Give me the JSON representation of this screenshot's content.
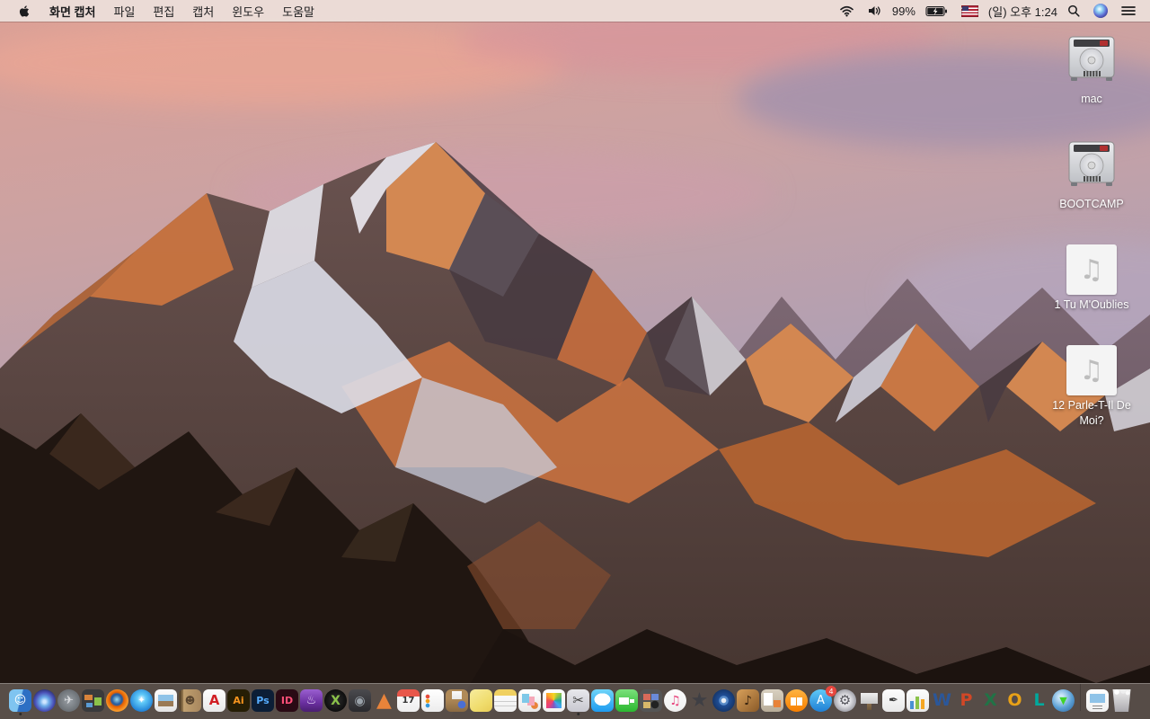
{
  "menu_bar": {
    "apple_menu": {
      "icon": "apple-logo"
    },
    "items": [
      {
        "id": "app-name",
        "label": "화면 캡처",
        "bold": true
      },
      {
        "id": "file",
        "label": "파일"
      },
      {
        "id": "edit",
        "label": "편집"
      },
      {
        "id": "capture",
        "label": "캡처"
      },
      {
        "id": "window",
        "label": "윈도우"
      },
      {
        "id": "help",
        "label": "도움말"
      }
    ],
    "status": {
      "wifi_icon": "wifi",
      "volume_icon": "speaker-on",
      "battery_percent": "99%",
      "battery_icon": "battery-charging",
      "input_source_icon": "us-flag",
      "clock": "(일) 오후 1:24",
      "spotlight_icon": "magnifier",
      "siri_icon": "siri-orb",
      "notification_icon": "list-lines"
    }
  },
  "desktop": {
    "icons": [
      {
        "id": "mac",
        "label": "mac",
        "type": "drive"
      },
      {
        "id": "bootcamp",
        "label": "BOOTCAMP",
        "type": "drive"
      },
      {
        "id": "tu-moublies",
        "label": "1 Tu M'Oublies",
        "type": "audio",
        "glyph": "♫"
      },
      {
        "id": "parle-t-il-de-moi",
        "label": "12 Parle-T-Il De Moi?",
        "type": "audio",
        "glyph": "♫"
      }
    ]
  },
  "dock": {
    "items": [
      {
        "id": "finder",
        "shape": "rounded",
        "bg": "linear-gradient(105deg,#7fc4f0 48%,#2d6fc4 52%)",
        "glyph": "☺",
        "glyph_color": "#ffffff",
        "glyph_size": 13,
        "running": true
      },
      {
        "id": "siri",
        "shape": "circle",
        "bg": "radial-gradient(circle at 50% 55%,#cfe6ff 8%,#6aa9e8 28%,#4b52b8 55%,#1e2250 85%)"
      },
      {
        "id": "launchpad",
        "shape": "circle",
        "bg": "radial-gradient(circle,#9aa0a6 0%,#6b7075 70%,#55585c 100%)",
        "glyph": "✈",
        "glyph_color": "#d8dadd",
        "glyph_size": 13
      },
      {
        "id": "mission-control",
        "shape": "rounded",
        "bg": "linear-gradient(#d8833b,#d8833b) 3px 6px/9px 6px no-repeat, linear-gradient(#8bc34a,#8bc34a) 14px 9px/8px 9px no-repeat, linear-gradient(#5a9bd4,#5a9bd4) 5px 15px/7px 5px no-repeat, #3a3a3c"
      },
      {
        "id": "firefox",
        "shape": "circle",
        "bg": "radial-gradient(circle at 48% 45%,#9adcf0 0%,#2a5d9e 28%,#2a5d9e 33%,#e66000 42%,#f79c2d 68%,#cf5a00 95%)"
      },
      {
        "id": "safari",
        "shape": "circle",
        "bg": "radial-gradient(circle at 50% 42%,#e8f6ff 0%,#5fc9f8 25%,#1f7fd4 75%)",
        "glyph": "✦",
        "glyph_color": "#ffffff",
        "glyph_size": 10
      },
      {
        "id": "preview",
        "shape": "rounded",
        "bg": "linear-gradient(180deg,#8fc3e8 55%,#9a7a55 55%) 4px 6px/17px 13px no-repeat, linear-gradient(#fdfdfd,#e4e4e4)"
      },
      {
        "id": "contacts",
        "shape": "rounded",
        "bg": "linear-gradient(90deg,#5f4a2f 0px,#5f4a2f 3px,#8a6f48 3px,#8a6f48 5px,#c0a070 5px,#a8875e 100%)",
        "glyph": "☻",
        "glyph_color": "#5a4630",
        "glyph_size": 11
      },
      {
        "id": "acrobat-reader",
        "shape": "rounded",
        "bg": "linear-gradient(#fdfdfd,#e9e9e9)",
        "glyph": "A",
        "glyph_color": "#d11f25",
        "glyph_size": 15,
        "bold": true
      },
      {
        "id": "illustrator",
        "shape": "rounded",
        "bg": "#261e05",
        "glyph": "Ai",
        "glyph_color": "#f7941e",
        "glyph_size": 11,
        "bold": true
      },
      {
        "id": "photoshop",
        "shape": "rounded",
        "bg": "#0c1e36",
        "glyph": "Ps",
        "glyph_color": "#56adff",
        "glyph_size": 11,
        "bold": true
      },
      {
        "id": "indesign",
        "shape": "rounded",
        "bg": "#2a0a14",
        "glyph": "ID",
        "glyph_color": "#ff4f78",
        "glyph_size": 11,
        "bold": true
      },
      {
        "id": "toast",
        "shape": "rounded",
        "bg": "linear-gradient(180deg,#9a5fd0 0%,#6a2fa0 60%,#4a1f70 100%)",
        "glyph": "♨",
        "glyph_color": "#e8d4f8",
        "glyph_size": 13
      },
      {
        "id": "x-media-app",
        "shape": "circle",
        "bg": "radial-gradient(circle,#2e2e2e,#000000)",
        "glyph": "X",
        "glyph_color": "#8bc34a",
        "glyph_size": 14,
        "bold": true
      },
      {
        "id": "disc-media-app",
        "shape": "rounded",
        "bg": "linear-gradient(#4a4a4e,#2a2a2e)",
        "glyph": "◉",
        "glyph_color": "#9aa2aa",
        "glyph_size": 14
      },
      {
        "id": "vlc",
        "shape": "none",
        "glyph": "▲",
        "glyph_color": "#e8833a",
        "glyph_size": 22
      },
      {
        "id": "calendar",
        "shape": "rounded",
        "bg": "linear-gradient(#e8574a,#e8574a) 0 0/100% 8px no-repeat, linear-gradient(#fdfdfd,#eeeeee)",
        "glyph": "17",
        "glyph_color": "#333333",
        "glyph_size": 10,
        "bold": true
      },
      {
        "id": "reminders",
        "shape": "rounded",
        "bg": "radial-gradient(circle at 7px 8px,#e74c3c 2px,rgba(0,0,0,0) 2.6px), radial-gradient(circle at 7px 13px,#f39c12 2px,rgba(0,0,0,0) 2.6px), radial-gradient(circle at 7px 18px,#3498db 2px,rgba(0,0,0,0) 2.6px), linear-gradient(#ffffff,#ececec)"
      },
      {
        "id": "unarchiver",
        "shape": "rounded",
        "bg": "linear-gradient(#fafafa,#e8e8e8) 7px 2px/11px 9px no-repeat, radial-gradient(circle at 18px 17px,#4a6fd4 4px,rgba(0,0,0,0) 4.6px), linear-gradient(180deg,#b08a58 40%,#8a6a42)"
      },
      {
        "id": "stickies",
        "shape": "rounded",
        "bg": "linear-gradient(145deg,#f7ec9e 0%,#f0dd6e 60%,#e8cc55 100%)"
      },
      {
        "id": "notes",
        "shape": "rounded",
        "bg": "linear-gradient(#f0d060,#f0d060) 0 0/100% 7px no-repeat, linear-gradient(#cccccc,#cccccc) 0 13px/100% 1px no-repeat, linear-gradient(#cccccc,#cccccc) 0 18px/100% 1px no-repeat, linear-gradient(#fdfdfd,#f0f0f0)"
      },
      {
        "id": "documents-app",
        "shape": "rounded",
        "bg": "linear-gradient(#7ec8e8,#7ec8e8) 4px 5px/8px 10px no-repeat, linear-gradient(#f5a8b8,#f5a8b8) 10px 8px/8px 10px no-repeat, radial-gradient(circle at 18px 18px,#e8833a 3.5px,rgba(0,0,0,0) 4.2px), linear-gradient(#ffffff,#e8e8e8)"
      },
      {
        "id": "photos",
        "shape": "rounded",
        "bg": "conic-gradient(from 0deg,#f5d623,#8bc34a,#26a69a,#42a5f5,#7e57c2,#ec407a,#ef5350,#ffa726,#f5d623) 50% 50%/17px 17px no-repeat, linear-gradient(#ffffff,#f0f0f0)"
      },
      {
        "id": "grab-screen-capture",
        "shape": "rounded",
        "bg": "linear-gradient(#e8e8ec,#c8c8d0)",
        "glyph": "✂",
        "glyph_color": "#444444",
        "glyph_size": 15,
        "running": true
      },
      {
        "id": "messages",
        "shape": "rounded",
        "bg": "radial-gradient(ellipse 9px 7px at 50% 45%,#ffffff 98%,rgba(0,0,0,0) 100%), linear-gradient(180deg,#6fd4f8,#1d9bf0)"
      },
      {
        "id": "facetime",
        "shape": "rounded",
        "bg": "linear-gradient(#ffffff,#ffffff) 4px 9px/11px 8px no-repeat, linear-gradient(#ffffff,#ffffff) 16px 11px/5px 4px no-repeat, linear-gradient(180deg,#7ae07a,#2bb830)"
      },
      {
        "id": "photo-booth",
        "shape": "rounded",
        "bg": "linear-gradient(#d86a5a,#d86a5a) 4px 5px/8px 7px no-repeat, linear-gradient(#6a8ad8,#6a8ad8) 13px 5px/8px 7px no-repeat, linear-gradient(#d8b86a,#d8b86a) 4px 14px/8px 7px no-repeat, radial-gradient(circle at 17px 17px,#222222 4px,#555555 4.6px), linear-gradient(#3a3236,#241f22)"
      },
      {
        "id": "itunes",
        "shape": "circle",
        "bg": "linear-gradient(#fdfdfd,#f0f0f0)",
        "glyph": "♫",
        "glyph_color": "#e8457d",
        "glyph_size": 14
      },
      {
        "id": "imovie",
        "shape": "none",
        "glyph": "★",
        "glyph_color": "#3f3f44",
        "glyph_size": 22
      },
      {
        "id": "dvd-player",
        "shape": "circle",
        "bg": "radial-gradient(circle,#e8eef5 0px,#e8eef5 2.5px,#5a8cc8 3px,#5a8cc8 5px,#1f4f98 5.5px,#16386e 12px)"
      },
      {
        "id": "garageband",
        "shape": "rounded",
        "bg": "linear-gradient(135deg,#d8a05a,#8a5a28)",
        "glyph": "♪",
        "glyph_color": "#3a2510",
        "glyph_size": 14
      },
      {
        "id": "publishing-app",
        "shape": "rounded",
        "bg": "linear-gradient(#ffffff,#ffffff) 3px 4px/10px 14px no-repeat, linear-gradient(#e8833a,#e8833a) 14px 12px/8px 8px no-repeat, linear-gradient(#d8d0c0,#b8ac98)"
      },
      {
        "id": "ibooks",
        "shape": "circle",
        "bg": "linear-gradient(#ffffff,#ffffff) 6px 9px/6px 9px no-repeat, linear-gradient(#ffffff,#ffffff) 13px 9px/6px 9px no-repeat, linear-gradient(180deg,#ffb340,#f77f00)"
      },
      {
        "id": "app-store",
        "shape": "circle",
        "bg": "linear-gradient(180deg,#5fc9f8,#1f7fd4)",
        "glyph": "A",
        "glyph_color": "#ffffff",
        "glyph_size": 13,
        "badge": "4"
      },
      {
        "id": "system-preferences",
        "shape": "circle",
        "bg": "radial-gradient(circle,#e8e8ec 30%,#9a9aa2 75%,#6a6a72)",
        "glyph": "⚙",
        "glyph_color": "#55555c",
        "glyph_size": 15
      },
      {
        "id": "keynote",
        "shape": "none",
        "bg": "linear-gradient(#f0f0f0,#c8c8c8) 3px 4px/19px 12px no-repeat, linear-gradient(#8a6f4d,#6a5538) 10px 16px/5px 7px no-repeat",
        "glyph": ""
      },
      {
        "id": "pages",
        "shape": "rounded",
        "bg": "linear-gradient(#fdfdfd,#e8e8e8)",
        "glyph": "✒",
        "glyph_color": "#3a3a3a",
        "glyph_size": 13
      },
      {
        "id": "numbers",
        "shape": "rounded",
        "bg": "linear-gradient(#4a90d2,#4a90d2) 4px 13px/4px 9px no-repeat, linear-gradient(#8bc34a,#8bc34a) 10px 8px/4px 14px no-repeat, linear-gradient(#f5a623,#f5a623) 16px 11px/4px 11px no-repeat, linear-gradient(#fdfdfd,#e8e8e8)"
      },
      {
        "id": "ms-word",
        "shape": "none",
        "glyph": "W",
        "glyph_color": "#2b579a",
        "glyph_size": 19,
        "bold": true
      },
      {
        "id": "ms-powerpoint",
        "shape": "none",
        "glyph": "P",
        "glyph_color": "#d24726",
        "glyph_size": 19,
        "bold": true
      },
      {
        "id": "ms-excel",
        "shape": "none",
        "glyph": "X",
        "glyph_color": "#217346",
        "glyph_size": 19,
        "bold": true
      },
      {
        "id": "ms-outlook",
        "shape": "none",
        "glyph": "O",
        "glyph_color": "#e8a117",
        "glyph_size": 19,
        "bold": true
      },
      {
        "id": "ms-lync",
        "shape": "none",
        "glyph": "L",
        "glyph_color": "#00a99d",
        "glyph_size": 19,
        "bold": true
      },
      {
        "id": "downloader",
        "shape": "circle",
        "bg": "radial-gradient(circle at 40% 35%,#cfe8f8 10%,#5a9fd4 55%,#2a5f98)",
        "glyph": "▼",
        "glyph_color": "#3fd42a",
        "glyph_size": 11,
        "bold": true
      },
      {
        "id": "separator",
        "type": "separator"
      },
      {
        "id": "image-file",
        "shape": "rounded",
        "bg": "linear-gradient(#8fc3e8,#8fc3e8) 4px 5px/17px 10px no-repeat, linear-gradient(#888888,#888888) 7px 18px/11px 1px no-repeat, linear-gradient(#888888,#888888) 7px 21px/11px 1px no-repeat, linear-gradient(#fdfdfd,#f0f0f0)"
      },
      {
        "id": "trash",
        "shape": "none",
        "bg": "radial-gradient(circle at 7px 3px,#ffffff 2.5px,rgba(0,0,0,0) 3px), radial-gradient(circle at 14px 2px,#eeeeee 2.5px,rgba(0,0,0,0) 3px), radial-gradient(circle at 19px 4px,#f8f8f8 2px,rgba(0,0,0,0) 2.6px), linear-gradient(180deg,rgba(255,255,255,0.9),rgba(185,185,192,0.85))",
        "clip": "polygon(10% 0, 90% 0, 80% 100%, 20% 100%)"
      }
    ]
  }
}
